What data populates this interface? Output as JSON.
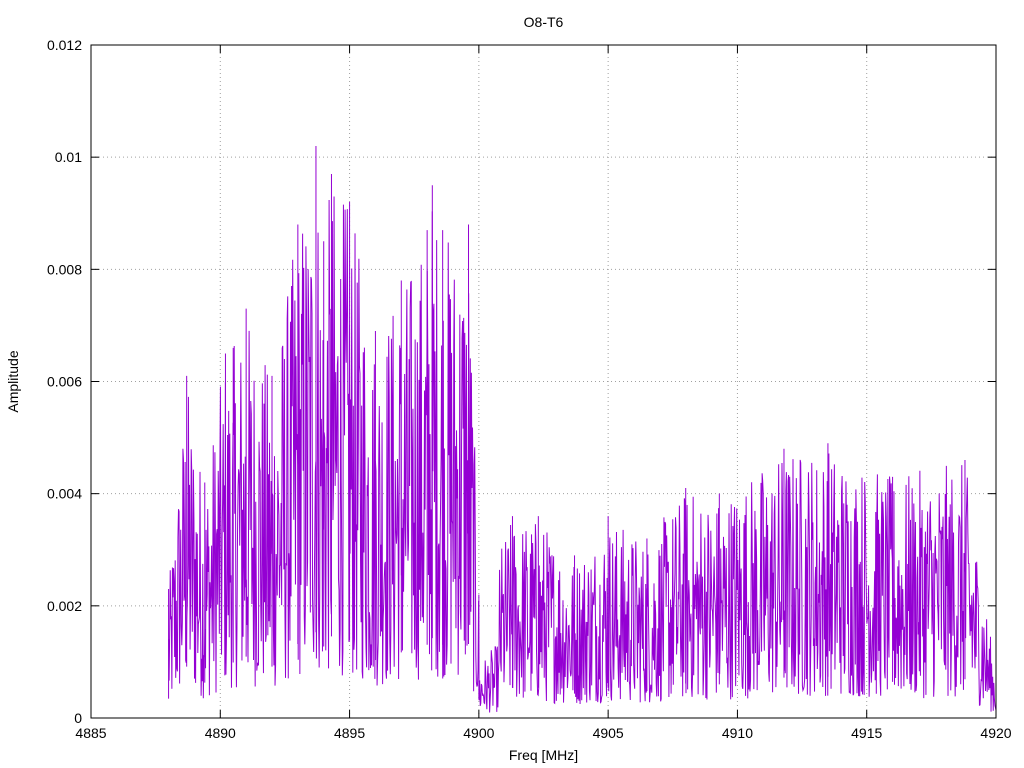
{
  "chart_data": {
    "type": "line",
    "title": "O8-T6",
    "xlabel": "Freq [MHz]",
    "ylabel": "Amplitude",
    "xlim": [
      4885,
      4920
    ],
    "ylim": [
      0,
      0.012
    ],
    "xticks": [
      4885,
      4890,
      4895,
      4900,
      4905,
      4910,
      4915,
      4920
    ],
    "yticks": [
      0,
      0.002,
      0.004,
      0.006,
      0.008,
      0.01,
      0.012
    ],
    "xtick_labels": [
      "4885",
      "4890",
      "4895",
      "4900",
      "4905",
      "4910",
      "4915",
      "4920"
    ],
    "ytick_labels": [
      "0",
      "0.002",
      "0.004",
      "0.006",
      "0.008",
      "0.01",
      "0.012"
    ],
    "grid": true,
    "series": [
      {
        "color": "#9400d3",
        "x_start": 4888.0,
        "x_end": 4920.0,
        "peaks": [
          {
            "x": 4888.0,
            "y": 0.0023
          },
          {
            "x": 4888.7,
            "y": 0.0061
          },
          {
            "x": 4889.4,
            "y": 0.0042
          },
          {
            "x": 4890.2,
            "y": 0.0065
          },
          {
            "x": 4890.5,
            "y": 0.0066
          },
          {
            "x": 4891.0,
            "y": 0.0073
          },
          {
            "x": 4892.0,
            "y": 0.0061
          },
          {
            "x": 4893.0,
            "y": 0.0088
          },
          {
            "x": 4893.7,
            "y": 0.0102
          },
          {
            "x": 4894.0,
            "y": 0.0085
          },
          {
            "x": 4894.3,
            "y": 0.0097
          },
          {
            "x": 4895.0,
            "y": 0.0092
          },
          {
            "x": 4896.0,
            "y": 0.0069
          },
          {
            "x": 4897.0,
            "y": 0.0078
          },
          {
            "x": 4898.0,
            "y": 0.0087
          },
          {
            "x": 4898.2,
            "y": 0.0095
          },
          {
            "x": 4898.6,
            "y": 0.0087
          },
          {
            "x": 4899.6,
            "y": 0.0088
          },
          {
            "x": 4900.0,
            "y": 0.0022
          },
          {
            "x": 4901.3,
            "y": 0.0036
          },
          {
            "x": 4902.3,
            "y": 0.0036
          },
          {
            "x": 4903.7,
            "y": 0.0029
          },
          {
            "x": 4905.0,
            "y": 0.0036
          },
          {
            "x": 4906.5,
            "y": 0.0032
          },
          {
            "x": 4908.0,
            "y": 0.0041
          },
          {
            "x": 4909.3,
            "y": 0.004
          },
          {
            "x": 4911.8,
            "y": 0.0048
          },
          {
            "x": 4913.5,
            "y": 0.0049
          },
          {
            "x": 4916.0,
            "y": 0.0043
          },
          {
            "x": 4918.8,
            "y": 0.0046
          },
          {
            "x": 4920.0,
            "y": 0.0008
          }
        ]
      }
    ]
  }
}
